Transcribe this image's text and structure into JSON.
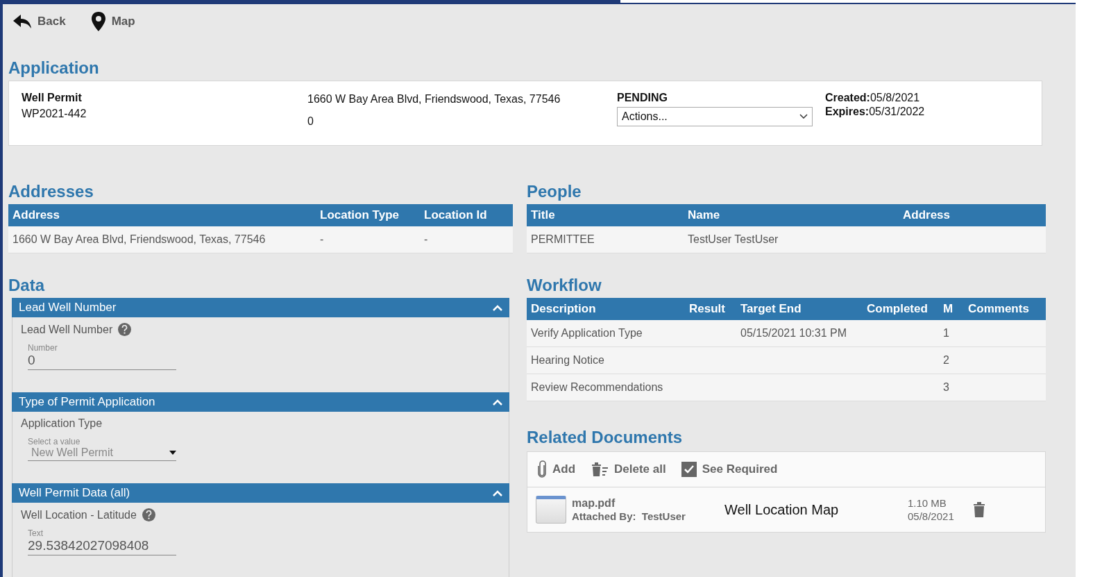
{
  "toolbar": [
    {
      "kind": "back",
      "label": "Back"
    },
    {
      "kind": "map",
      "label": "Map"
    }
  ],
  "application": {
    "title": "Application",
    "type": "Well Permit",
    "number": "WP2021-442",
    "address": "1660 W Bay Area Blvd, Friendswood, Texas, 77546",
    "line_2": "0",
    "status": "PENDING",
    "actions": {
      "value": "Actions..."
    },
    "created_label": "Created:",
    "created": "05/8/2021",
    "expires_label": "Expires:",
    "expires": "05/31/2022"
  },
  "addresses": {
    "title": "Addresses",
    "columns": [
      "Address",
      "Location Type",
      "Location Id"
    ],
    "rows": [
      [
        "1660 W Bay Area Blvd, Friendswood, Texas, 77546",
        "-",
        "-"
      ]
    ]
  },
  "people": {
    "title": "People",
    "columns": [
      "Title",
      "Name",
      "Address"
    ],
    "rows": [
      [
        "PERMITTEE",
        "TestUser TestUser",
        ""
      ]
    ]
  },
  "data": {
    "title": "Data",
    "panels": [
      {
        "title": "Lead Well Number",
        "expanded": true,
        "fields": [
          {
            "kind": "text",
            "label": "Lead Well Number",
            "help": true,
            "caption": "Number",
            "value": "0"
          }
        ]
      },
      {
        "title": "Type of Permit Application",
        "expanded": true,
        "fields": [
          {
            "kind": "select",
            "label": "Application Type",
            "help": false,
            "caption": "Select a value",
            "value": "New Well Permit"
          }
        ]
      },
      {
        "title": "Well Permit Data (all)",
        "expanded": true,
        "fields": [
          {
            "kind": "text",
            "label": "Well Location - Latitude",
            "help": true,
            "caption": "Text",
            "value": "29.53842027098408"
          }
        ]
      }
    ]
  },
  "workflow": {
    "title": "Workflow",
    "columns": [
      "Description",
      "Result",
      "Target End",
      "Completed",
      "M",
      "Comments"
    ],
    "rows": [
      [
        "Verify Application Type",
        "",
        "05/15/2021 10:31 PM",
        "",
        "1",
        ""
      ],
      [
        "Hearing Notice",
        "",
        "",
        "",
        "2",
        ""
      ],
      [
        "Review Recommendations",
        "",
        "",
        "",
        "3",
        ""
      ]
    ]
  },
  "related_documents": {
    "title": "Related Documents",
    "actions": [
      {
        "kind": "add",
        "label": "Add"
      },
      {
        "kind": "delete",
        "label": "Delete all"
      },
      {
        "kind": "check",
        "label": "See Required",
        "checked": true
      }
    ],
    "files": [
      {
        "name": "map.pdf",
        "attached_label": "Attached By:",
        "attached_by": "TestUser",
        "description": "Well Location Map",
        "size": "1.10 MB",
        "date": "05/8/2021"
      }
    ]
  }
}
